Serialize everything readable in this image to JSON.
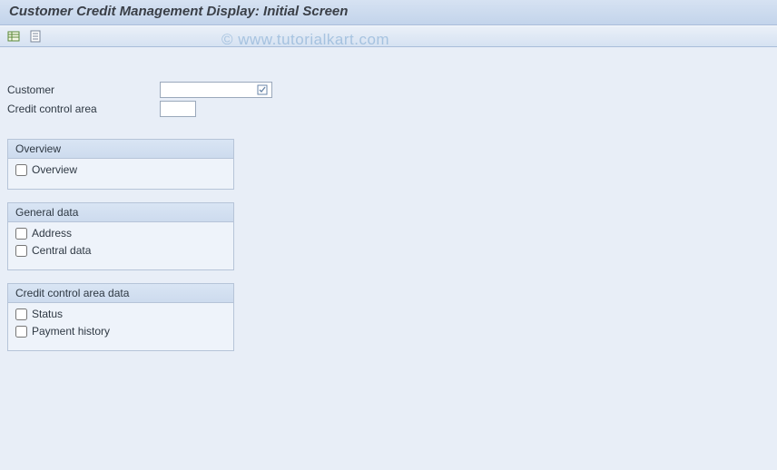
{
  "title": "Customer Credit Management Display: Initial Screen",
  "watermark": "© www.tutorialkart.com",
  "toolbar": {
    "btn1_name": "administrative-data-icon",
    "btn2_name": "texts-icon"
  },
  "fields": {
    "customer": {
      "label": "Customer",
      "value": ""
    },
    "credit_control_area": {
      "label": "Credit control area",
      "value": ""
    }
  },
  "groups": [
    {
      "title": "Overview",
      "items": [
        {
          "label": "Overview",
          "checked": false
        }
      ]
    },
    {
      "title": "General data",
      "items": [
        {
          "label": "Address",
          "checked": false
        },
        {
          "label": "Central data",
          "checked": false
        }
      ]
    },
    {
      "title": "Credit control area data",
      "items": [
        {
          "label": "Status",
          "checked": false
        },
        {
          "label": "Payment history",
          "checked": false
        }
      ]
    }
  ]
}
